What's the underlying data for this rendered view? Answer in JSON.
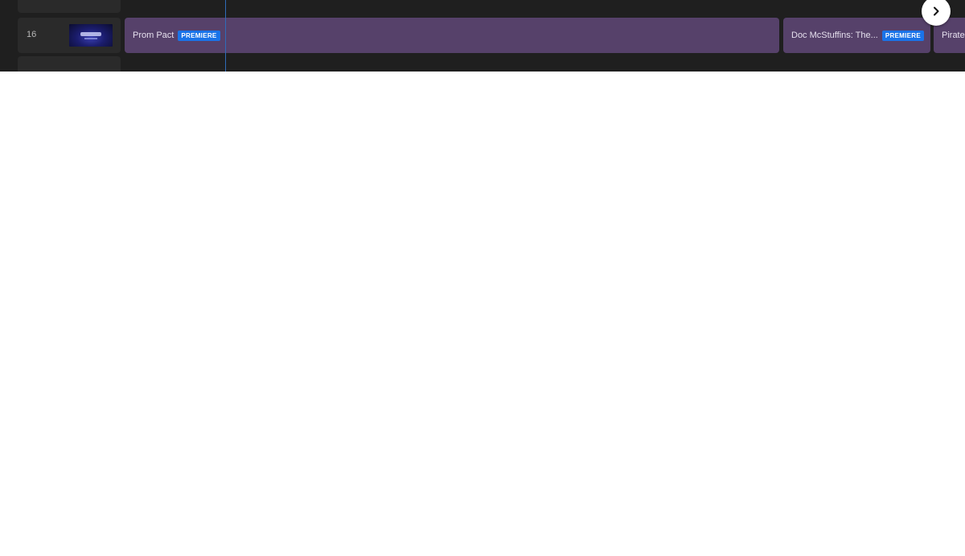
{
  "guide": {
    "channel": {
      "number": "16",
      "logo_icon": "channel-logo-icon"
    },
    "programs": [
      {
        "title": "Prom Pact",
        "badge": "PREMIERE"
      },
      {
        "title": "Doc McStuffins: The...",
        "badge": "PREMIERE"
      },
      {
        "title": "Pirate",
        "badge": ""
      }
    ],
    "next_button_icon": "chevron-right-icon"
  },
  "colors": {
    "background": "#1f1f1f",
    "program_block": "#56416a",
    "badge": "#1a73e8",
    "now_line": "#2f6cb8"
  }
}
